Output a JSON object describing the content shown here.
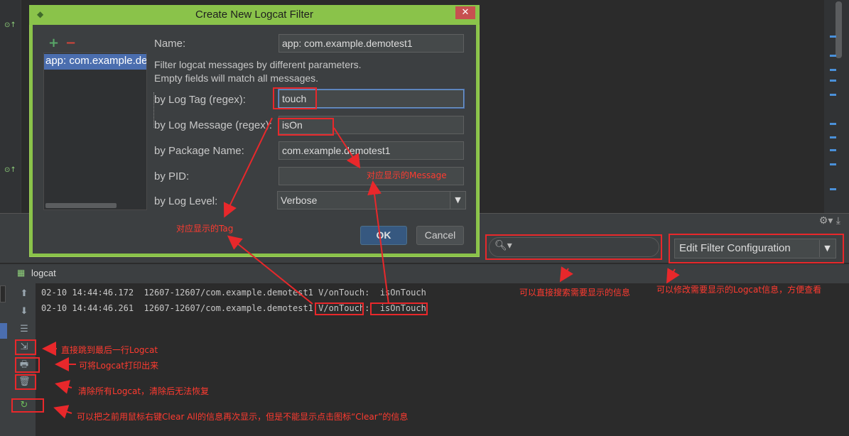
{
  "dialog": {
    "title": "Create New Logcat Filter",
    "close_icon": "close-icon",
    "add_icon": "+",
    "remove_icon": "−",
    "filter_list": [
      "app: com.example.demotest1"
    ],
    "name_label": "Name:",
    "name_value": "app: com.example.demotest1",
    "description_line1": "Filter logcat messages by different parameters.",
    "description_line2": "Empty fields will match all messages.",
    "log_tag_label": "by Log Tag (regex):",
    "log_tag_value": "touch",
    "log_message_label": "by Log Message (regex):",
    "log_message_value": "isOn",
    "package_label": "by Package Name:",
    "package_value": "com.example.demotest1",
    "pid_label": "by PID:",
    "pid_value": "",
    "log_level_label": "by Log Level:",
    "log_level_value": "Verbose",
    "ok_label": "OK",
    "cancel_label": "Cancel"
  },
  "logcat": {
    "tab_label": "logcat",
    "filter_config_value": "Edit Filter Configuration",
    "search_placeholder": "",
    "lines": [
      "02-10 14:44:46.172  12607-12607/com.example.demotest1 V/onTouch:  isOnTouch",
      "02-10 14:44:46.261  12607-12607/com.example.demotest1 V/onTouch:  isOnTouch"
    ]
  },
  "annotations": {
    "tag": "对应显示的Tag",
    "message": "对应显示的Message",
    "search": "可以直接搜索需要显示的信息",
    "filter_config": "可以修改需要显示的Logcat信息，方便查看",
    "scroll_to_end": "直接跳到最后一行Logcat",
    "print": "可将Logcat打印出来",
    "clear": "清除所有Logcat，清除后无法恢复",
    "restart": "可以把之前用鼠标右键Clear All的信息再次显示，但是不能显示点击图标“Clear”的信息"
  },
  "colors": {
    "annotation_red": "#e8282b",
    "dialog_border_green": "#8ac34a",
    "selection_blue": "#4b6eaf"
  }
}
